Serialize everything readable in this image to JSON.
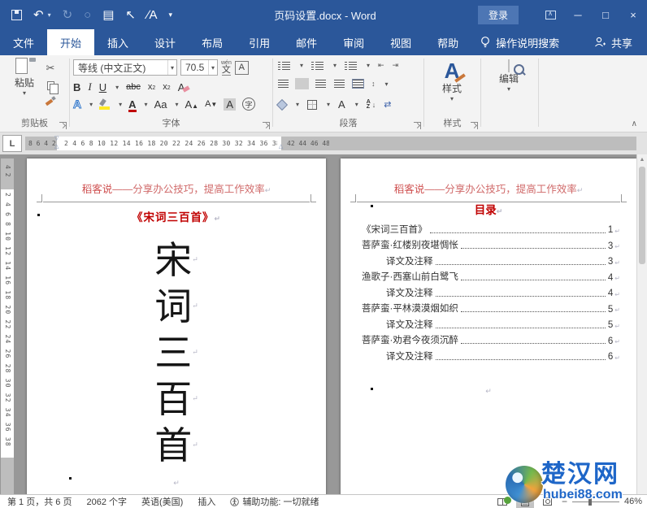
{
  "title_bar": {
    "title": "页码设置.docx - Word",
    "sign_in": "登录"
  },
  "tabs": {
    "items": [
      {
        "label": "文件"
      },
      {
        "label": "开始"
      },
      {
        "label": "插入"
      },
      {
        "label": "设计"
      },
      {
        "label": "布局"
      },
      {
        "label": "引用"
      },
      {
        "label": "邮件"
      },
      {
        "label": "审阅"
      },
      {
        "label": "视图"
      },
      {
        "label": "帮助"
      }
    ],
    "search": "操作说明搜索",
    "share": "共享"
  },
  "ribbon": {
    "clipboard": {
      "paste": "粘贴",
      "group": "剪贴板"
    },
    "font": {
      "name": "等线 (中文正文)",
      "size": "70.5",
      "bold": "B",
      "italic": "I",
      "underline": "U",
      "strike": "abc",
      "sub_base": "x",
      "sub_mark": "2",
      "sup_base": "x",
      "sup_mark": "2",
      "phonetic_top": "wén",
      "phonetic_bottom": "文",
      "border_a": "A",
      "effects_a": "A",
      "color_a": "A",
      "clear_a": "A",
      "aa": "Aa",
      "grow": "A",
      "shrink": "A",
      "shade_a": "A",
      "enclose": "字",
      "group": "字体"
    },
    "paragraph": {
      "group": "段落",
      "sort_a": "A",
      "sort_z": "Z",
      "sort_arrow": "↓",
      "asian_a": "A",
      "marks": "⇄",
      "spacing": "↕",
      "outdent": "⇤",
      "indent": "⇥"
    },
    "styles": {
      "button": "样式",
      "group": "样式",
      "icon_a": "A"
    },
    "editing": {
      "button": "编辑"
    }
  },
  "ruler": {
    "tab_selector": "L",
    "h_left": "8 6 4 2",
    "h_mid": "2 4 6 8 10 12 14 16 18 20 22 24 26 28 30 32 34 36 38",
    "h_right": "42 44 46 48",
    "v_top": "4 2",
    "v_mid": "2 4 6 8 10 12 14 16 18 20 22 24 26 28 30 32 34 36 38"
  },
  "pages": {
    "left": {
      "header_brand": "稻客说",
      "header_rest": "——分享办公技巧，提高工作效率",
      "title": "《宋词三百首》",
      "chars": [
        {
          "c": "宋"
        },
        {
          "c": "词"
        },
        {
          "c": "三"
        },
        {
          "c": "百"
        },
        {
          "c": "首"
        }
      ]
    },
    "right": {
      "header_brand": "稻客说",
      "header_rest": "——分享办公技巧，提高工作效率",
      "toc_title": "目录",
      "toc": [
        {
          "label": "《宋词三百首》",
          "page": "1"
        },
        {
          "label": "菩萨蛮·红楼别夜堪惆怅",
          "page": "3"
        },
        {
          "label": "译文及注释",
          "page": "3"
        },
        {
          "label": "渔歌子·西塞山前白鹭飞",
          "page": "4"
        },
        {
          "label": "译文及注释",
          "page": "4"
        },
        {
          "label": "菩萨蛮·平林漠漠烟如织",
          "page": "5"
        },
        {
          "label": "译文及注释",
          "page": "5"
        },
        {
          "label": "菩萨蛮·劝君今夜须沉醉",
          "page": "6"
        },
        {
          "label": "译文及注释",
          "page": "6"
        }
      ]
    }
  },
  "status_bar": {
    "page_info": "第 1 页，共 6 页",
    "word_count": "2062 个字",
    "language": "英语(美国)",
    "insert_mode": "插入",
    "accessibility": "辅助功能: 一切就绪",
    "zoom_percent": "46%"
  },
  "watermark": {
    "name": "楚汉网",
    "url": "hubei88.com"
  },
  "glyphs": {
    "pilcrow": "↵",
    "undo": "↶",
    "redo": "↻",
    "circle": "○",
    "win": "▤",
    "cursor": "↖",
    "slash_a": "∕A",
    "caret_down": "▾",
    "caret_up": "∧",
    "minimize": "─",
    "maximize": "□",
    "close": "×",
    "up_small": "▲",
    "dn_small": "▼",
    "tri_dn": "▽",
    "tri_up": "△"
  }
}
